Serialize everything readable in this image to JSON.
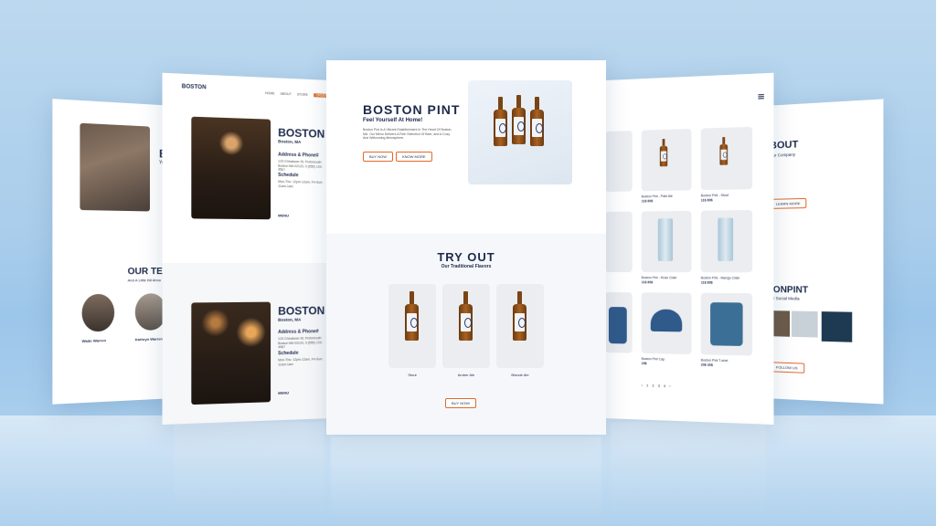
{
  "brand": {
    "logo_text": "BOSTON",
    "logo_sub": "PINT"
  },
  "hero": {
    "title": "BOSTON PINT",
    "tagline": "Feel Yourself At Home!",
    "body": "Boston Pint Is A Vibrant Establishment In The Heart Of Boston, MA. Our Menu Delivers A Rich Selection Of Beer, and A Cozy And Welcoming Atmosphere.",
    "btn_primary": "BUY NOW",
    "btn_secondary": "KNOW MORE"
  },
  "tryout": {
    "title": "TRY OUT",
    "subtitle": "Our Traditional Flavors",
    "products": [
      "Stout",
      "Amber Ale",
      "Blonde Ale"
    ],
    "cta": "BUY NOW!"
  },
  "locations": {
    "nav": [
      "HOME",
      "ABOUT",
      "STORE"
    ],
    "nav_cta": "ORDER",
    "title": "BOSTON P",
    "city": "Boston, MA",
    "address_heading": "Address & Phone#",
    "address_lines": "123 Chinatown St, Portsmouth Boston MA 02123, 0 (555) 123-4567",
    "schedule_heading": "Schedule",
    "schedule_lines": "Mon-Thu: 12pm-12am, Fri-Sun: 11am-1am",
    "menu_label": "MENU"
  },
  "about": {
    "title_fragment": "BO",
    "sub_fragment": "You",
    "team_title": "OUR TEA",
    "team_sub": "And A Little Bit Abou",
    "members": [
      "Wade Warren",
      "Kathryn Warren"
    ]
  },
  "store": {
    "items": [
      {
        "name": "Boston Pint - Pale Ale",
        "price": "11$ 80$"
      },
      {
        "name": "Boston Pint - Stout",
        "price": "11$ 80$"
      },
      {
        "name": "Boston Pint - Rose Cider",
        "price": "11$ 80$"
      },
      {
        "name": "Boston Pint - Mango Cider",
        "price": "11$ 80$"
      },
      {
        "name": "Boston Pint Cap",
        "price": "15$"
      },
      {
        "name": "Boston Pint T-shirt",
        "price": "20$ 30$"
      }
    ],
    "pagination": [
      "1",
      "2",
      "3",
      "4"
    ]
  },
  "about_right": {
    "title": "BOUT",
    "subtitle": "Our Company",
    "btn": "LEARN MORE",
    "social_title": "TONPINT",
    "social_sub": "Our Social Media",
    "social_btn": "FOLLOW US"
  },
  "colors": {
    "navy": "#1d2a4a",
    "accent": "#e06a2a",
    "background": "#a9cdeb"
  }
}
